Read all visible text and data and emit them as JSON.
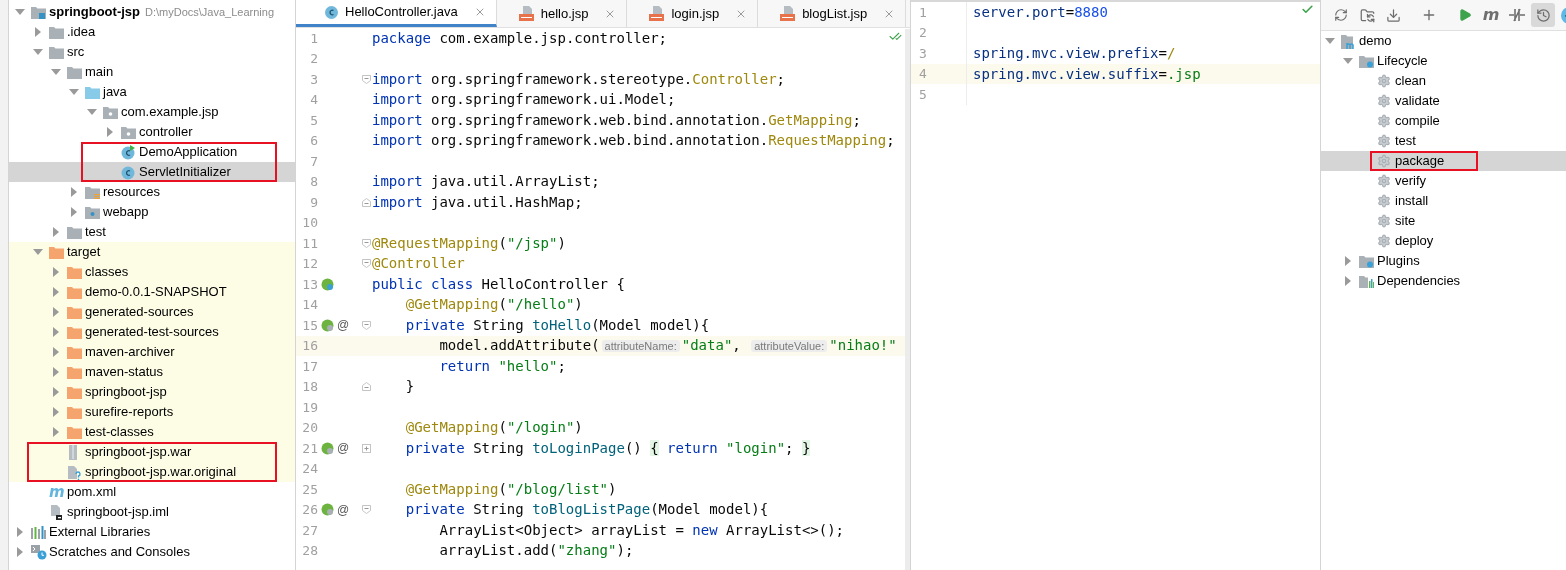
{
  "project_tree": {
    "items": [
      {
        "label": "springboot-jsp",
        "kind": "module",
        "bold": true,
        "path": "D:\\myDocs\\Java_Learning",
        "expanded": true,
        "selected": false,
        "framed": false,
        "children": [
          {
            "label": ".idea",
            "kind": "folder",
            "expanded": false,
            "selected": false,
            "framed": false
          },
          {
            "label": "src",
            "kind": "folder",
            "expanded": true,
            "selected": false,
            "framed": false,
            "children": [
              {
                "label": "main",
                "kind": "folder",
                "expanded": true,
                "selected": false,
                "framed": false,
                "children": [
                  {
                    "label": "java",
                    "kind": "source-folder",
                    "expanded": true,
                    "selected": false,
                    "framed": false,
                    "children": [
                      {
                        "label": "com.example.jsp",
                        "kind": "package",
                        "expanded": true,
                        "selected": false,
                        "framed": false,
                        "children": [
                          {
                            "label": "controller",
                            "kind": "package",
                            "expanded": false,
                            "selected": false,
                            "framed": false
                          },
                          {
                            "label": "DemoApplication",
                            "kind": "run-class",
                            "selected": false,
                            "framed": true
                          },
                          {
                            "label": "ServletInitializer",
                            "kind": "class",
                            "selected": true,
                            "framed": true
                          }
                        ]
                      }
                    ]
                  },
                  {
                    "label": "resources",
                    "kind": "resources",
                    "expanded": false,
                    "selected": false,
                    "framed": false
                  },
                  {
                    "label": "webapp",
                    "kind": "web-folder",
                    "expanded": false,
                    "selected": false,
                    "framed": false
                  }
                ]
              },
              {
                "label": "test",
                "kind": "folder",
                "expanded": false,
                "selected": false,
                "framed": false
              }
            ]
          },
          {
            "label": "target",
            "kind": "excluded-folder",
            "expanded": true,
            "selected": false,
            "framed": false,
            "excluded": true,
            "children": [
              {
                "label": "classes",
                "kind": "excluded-folder",
                "expanded": false,
                "selected": false,
                "framed": false
              },
              {
                "label": "demo-0.0.1-SNAPSHOT",
                "kind": "excluded-folder",
                "expanded": false,
                "selected": false,
                "framed": false
              },
              {
                "label": "generated-sources",
                "kind": "excluded-folder",
                "expanded": false,
                "selected": false,
                "framed": false
              },
              {
                "label": "generated-test-sources",
                "kind": "excluded-folder",
                "expanded": false,
                "selected": false,
                "framed": false
              },
              {
                "label": "maven-archiver",
                "kind": "excluded-folder",
                "expanded": false,
                "selected": false,
                "framed": false
              },
              {
                "label": "maven-status",
                "kind": "excluded-folder",
                "expanded": false,
                "selected": false,
                "framed": false
              },
              {
                "label": "springboot-jsp",
                "kind": "excluded-folder",
                "expanded": false,
                "selected": false,
                "framed": false
              },
              {
                "label": "surefire-reports",
                "kind": "excluded-folder",
                "expanded": false,
                "selected": false,
                "framed": false
              },
              {
                "label": "test-classes",
                "kind": "excluded-folder",
                "expanded": false,
                "selected": false,
                "framed": false
              },
              {
                "label": "springboot-jsp.war",
                "kind": "archive",
                "selected": false,
                "framed": true
              },
              {
                "label": "springboot-jsp.war.original",
                "kind": "unknown-file",
                "selected": false,
                "framed": true
              }
            ]
          },
          {
            "label": "pom.xml",
            "kind": "maven",
            "badge": "m",
            "selected": false,
            "framed": false
          },
          {
            "label": "springboot-jsp.iml",
            "kind": "iml",
            "selected": false,
            "framed": false
          }
        ]
      },
      {
        "label": "External Libraries",
        "kind": "libraries",
        "expanded": false,
        "selected": false,
        "framed": false
      },
      {
        "label": "Scratches and Consoles",
        "kind": "scratches",
        "expanded": false,
        "selected": false,
        "framed": false
      }
    ]
  },
  "editor": {
    "tabs": [
      {
        "label": "HelloController.java",
        "kind": "java",
        "selected": true
      },
      {
        "label": "hello.jsp",
        "kind": "jsp",
        "selected": false
      },
      {
        "label": "login.jsp",
        "kind": "jsp",
        "selected": false
      },
      {
        "label": "blogList.jsp",
        "kind": "jsp",
        "selected": false
      }
    ],
    "lines": [
      {
        "number": "1",
        "current": false,
        "tokens": [
          {
            "kind": "kw",
            "text": "package"
          },
          {
            "kind": "plain",
            "text": " com.example.jsp.controller;"
          }
        ]
      },
      {
        "number": "2",
        "current": false
      },
      {
        "number": "3",
        "current": false,
        "fold": {
          "kind": "start"
        },
        "tokens": [
          {
            "kind": "kw",
            "text": "import"
          },
          {
            "kind": "plain",
            "text": " org.springframework.stereotype."
          },
          {
            "kind": "cls",
            "text": "Controller"
          },
          {
            "kind": "plain",
            "text": ";"
          }
        ]
      },
      {
        "number": "4",
        "current": false,
        "tokens": [
          {
            "kind": "kw",
            "text": "import"
          },
          {
            "kind": "plain",
            "text": " org.springframework.ui.Model;"
          }
        ]
      },
      {
        "number": "5",
        "current": false,
        "tokens": [
          {
            "kind": "kw",
            "text": "import"
          },
          {
            "kind": "plain",
            "text": " org.springframework.web.bind.annotation."
          },
          {
            "kind": "cls",
            "text": "GetMapping"
          },
          {
            "kind": "plain",
            "text": ";"
          }
        ]
      },
      {
        "number": "6",
        "current": false,
        "tokens": [
          {
            "kind": "kw",
            "text": "import"
          },
          {
            "kind": "plain",
            "text": " org.springframework.web.bind.annotation."
          },
          {
            "kind": "cls",
            "text": "RequestMapping"
          },
          {
            "kind": "plain",
            "text": ";"
          }
        ]
      },
      {
        "number": "7",
        "current": false
      },
      {
        "number": "8",
        "current": false,
        "tokens": [
          {
            "kind": "kw",
            "text": "import"
          },
          {
            "kind": "plain",
            "text": " java.util.ArrayList;"
          }
        ]
      },
      {
        "number": "9",
        "current": false,
        "fold": {
          "kind": "end"
        },
        "tokens": [
          {
            "kind": "kw",
            "text": "import"
          },
          {
            "kind": "plain",
            "text": " java.util.HashMap;"
          }
        ]
      },
      {
        "number": "10",
        "current": false
      },
      {
        "number": "11",
        "current": false,
        "fold": {
          "kind": "start"
        },
        "tokens": [
          {
            "kind": "ann",
            "text": "@RequestMapping"
          },
          {
            "kind": "plain",
            "text": "("
          },
          {
            "kind": "str",
            "text": "\"/jsp\""
          },
          {
            "kind": "plain",
            "text": ")"
          }
        ]
      },
      {
        "number": "12",
        "current": false,
        "fold": {
          "kind": "start"
        },
        "tokens": [
          {
            "kind": "ann",
            "text": "@Controller"
          }
        ]
      },
      {
        "number": "13",
        "current": false,
        "marker": {
          "kind": "class"
        },
        "tokens": [
          {
            "kind": "kw",
            "text": "public class"
          },
          {
            "kind": "plain",
            "text": " HelloController {"
          }
        ]
      },
      {
        "number": "14",
        "current": false,
        "tokens": [
          {
            "kind": "ann",
            "text": "    @GetMapping"
          },
          {
            "kind": "plain",
            "text": "("
          },
          {
            "kind": "str",
            "text": "\"/hello\""
          },
          {
            "kind": "plain",
            "text": ")"
          }
        ]
      },
      {
        "number": "15",
        "current": false,
        "marker": {
          "kind": "method"
        },
        "at": "@",
        "fold": {
          "kind": "start"
        },
        "tokens": [
          {
            "kind": "kw",
            "text": "    private"
          },
          {
            "kind": "plain",
            "text": " String "
          },
          {
            "kind": "fn",
            "text": "toHello"
          },
          {
            "kind": "plain",
            "text": "(Model model){"
          }
        ]
      },
      {
        "number": "16",
        "current": true,
        "tokens": [
          {
            "kind": "plain",
            "text": "        model.addAttribute("
          },
          {
            "kind": "hint",
            "text": "attributeName:"
          },
          {
            "kind": "str",
            "text": "\"data\""
          },
          {
            "kind": "plain",
            "text": ", "
          },
          {
            "kind": "hint",
            "text": "attributeValue:"
          },
          {
            "kind": "str",
            "text": "\"nihao!\""
          }
        ]
      },
      {
        "number": "17",
        "current": false,
        "tokens": [
          {
            "kind": "kw",
            "text": "        return"
          },
          {
            "kind": "str",
            "text": " \"hello\""
          },
          {
            "kind": "plain",
            "text": ";"
          }
        ]
      },
      {
        "number": "18",
        "current": false,
        "fold": {
          "kind": "end"
        },
        "tokens": [
          {
            "kind": "plain",
            "text": "    }"
          }
        ]
      },
      {
        "number": "19",
        "current": false
      },
      {
        "number": "20",
        "current": false,
        "tokens": [
          {
            "kind": "ann",
            "text": "    @GetMapping"
          },
          {
            "kind": "plain",
            "text": "("
          },
          {
            "kind": "str",
            "text": "\"/login\""
          },
          {
            "kind": "plain",
            "text": ")"
          }
        ]
      },
      {
        "number": "21",
        "current": false,
        "marker": {
          "kind": "method"
        },
        "at": "@",
        "fold": {
          "kind": "collapsed"
        },
        "tokens": [
          {
            "kind": "kw",
            "text": "    private"
          },
          {
            "kind": "plain",
            "text": " String "
          },
          {
            "kind": "fn",
            "text": "toLoginPage"
          },
          {
            "kind": "plain",
            "text": "() "
          },
          {
            "kind": "fb",
            "text": "{"
          },
          {
            "kind": "kw",
            "text": " return"
          },
          {
            "kind": "str",
            "text": " \"login\""
          },
          {
            "kind": "plain",
            "text": "; "
          },
          {
            "kind": "fb",
            "text": "}"
          }
        ]
      },
      {
        "number": "24",
        "current": false
      },
      {
        "number": "25",
        "current": false,
        "tokens": [
          {
            "kind": "ann",
            "text": "    @GetMapping"
          },
          {
            "kind": "plain",
            "text": "("
          },
          {
            "kind": "str",
            "text": "\"/blog/list\""
          },
          {
            "kind": "plain",
            "text": ")"
          }
        ]
      },
      {
        "number": "26",
        "current": false,
        "marker": {
          "kind": "method"
        },
        "at": "@",
        "fold": {
          "kind": "start"
        },
        "tokens": [
          {
            "kind": "kw",
            "text": "    private"
          },
          {
            "kind": "plain",
            "text": " String "
          },
          {
            "kind": "fn",
            "text": "toBlogListPage"
          },
          {
            "kind": "plain",
            "text": "(Model model){"
          }
        ]
      },
      {
        "number": "27",
        "current": false,
        "tokens": [
          {
            "kind": "plain",
            "text": "        ArrayList<Object> arrayList = "
          },
          {
            "kind": "kw",
            "text": "new"
          },
          {
            "kind": "plain",
            "text": " ArrayList<>();"
          }
        ]
      },
      {
        "number": "28",
        "current": false,
        "tokens": [
          {
            "kind": "plain",
            "text": "        arrayList.add("
          },
          {
            "kind": "str",
            "text": "\"zhang\""
          },
          {
            "kind": "plain",
            "text": ");"
          }
        ]
      }
    ]
  },
  "properties_editor": {
    "lines": [
      {
        "number": "1",
        "current": false,
        "tokens": [
          {
            "kind": "key",
            "text": "server.port"
          },
          {
            "kind": "plain",
            "text": "="
          },
          {
            "kind": "num",
            "text": "8880"
          }
        ]
      },
      {
        "number": "2",
        "current": false
      },
      {
        "number": "3",
        "current": false,
        "tokens": [
          {
            "kind": "key",
            "text": "spring.mvc.view.prefix"
          },
          {
            "kind": "plain",
            "text": "="
          },
          {
            "kind": "cls",
            "text": "/"
          }
        ]
      },
      {
        "number": "4",
        "current": true,
        "tokens": [
          {
            "kind": "key",
            "text": "spring.mvc.view.suffix"
          },
          {
            "kind": "plain",
            "text": "="
          },
          {
            "kind": "str",
            "text": ".jsp"
          }
        ]
      },
      {
        "number": "5",
        "current": false
      }
    ]
  },
  "maven": {
    "toolbar": [
      {
        "kind": "refresh",
        "pressed": false
      },
      {
        "kind": "folder",
        "pressed": false
      },
      {
        "kind": "download",
        "pressed": false
      },
      {
        "kind": "separator"
      },
      {
        "kind": "plus",
        "pressed": false
      },
      {
        "kind": "separator"
      },
      {
        "kind": "run",
        "pressed": false
      },
      {
        "kind": "maven",
        "label": "m",
        "pressed": false
      },
      {
        "kind": "skip-tests",
        "pressed": false
      },
      {
        "kind": "offline",
        "pressed": true
      },
      {
        "kind": "lightning",
        "pressed": false
      }
    ],
    "items": [
      {
        "label": "demo",
        "kind": "maven-module",
        "expanded": true,
        "selected": false,
        "framed": false,
        "children": [
          {
            "label": "Lifecycle",
            "kind": "lifecycle",
            "expanded": true,
            "selected": false,
            "framed": false,
            "children": [
              {
                "label": "clean",
                "kind": "goal",
                "selected": false,
                "framed": false
              },
              {
                "label": "validate",
                "kind": "goal",
                "selected": false,
                "framed": false
              },
              {
                "label": "compile",
                "kind": "goal",
                "selected": false,
                "framed": false
              },
              {
                "label": "test",
                "kind": "goal",
                "selected": false,
                "framed": false
              },
              {
                "label": "package",
                "kind": "goal",
                "selected": true,
                "framed": true
              },
              {
                "label": "verify",
                "kind": "goal",
                "selected": false,
                "framed": false
              },
              {
                "label": "install",
                "kind": "goal",
                "selected": false,
                "framed": false
              },
              {
                "label": "site",
                "kind": "goal",
                "selected": false,
                "framed": false
              },
              {
                "label": "deploy",
                "kind": "goal",
                "selected": false,
                "framed": false
              }
            ]
          },
          {
            "label": "Plugins",
            "kind": "lifecycle",
            "expanded": false,
            "selected": false,
            "framed": false
          },
          {
            "label": "Dependencies",
            "kind": "dependencies",
            "expanded": false,
            "selected": false,
            "framed": false
          }
        ]
      }
    ]
  }
}
